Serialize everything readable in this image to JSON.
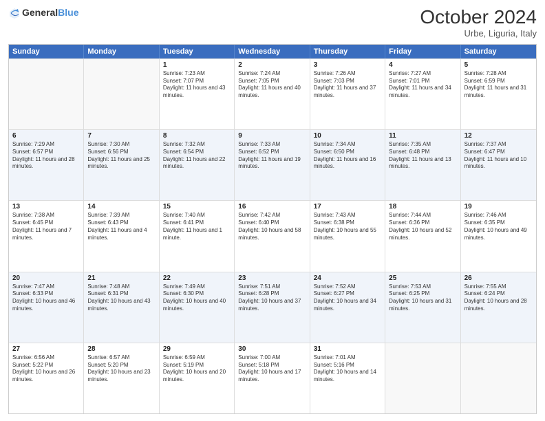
{
  "logo": {
    "text_general": "General",
    "text_blue": "Blue"
  },
  "header": {
    "month": "October 2024",
    "location": "Urbe, Liguria, Italy"
  },
  "weekdays": [
    "Sunday",
    "Monday",
    "Tuesday",
    "Wednesday",
    "Thursday",
    "Friday",
    "Saturday"
  ],
  "rows": [
    {
      "alt": false,
      "cells": [
        {
          "day": "",
          "empty": true,
          "info": ""
        },
        {
          "day": "",
          "empty": true,
          "info": ""
        },
        {
          "day": "1",
          "empty": false,
          "info": "Sunrise: 7:23 AM\nSunset: 7:07 PM\nDaylight: 11 hours and 43 minutes."
        },
        {
          "day": "2",
          "empty": false,
          "info": "Sunrise: 7:24 AM\nSunset: 7:05 PM\nDaylight: 11 hours and 40 minutes."
        },
        {
          "day": "3",
          "empty": false,
          "info": "Sunrise: 7:26 AM\nSunset: 7:03 PM\nDaylight: 11 hours and 37 minutes."
        },
        {
          "day": "4",
          "empty": false,
          "info": "Sunrise: 7:27 AM\nSunset: 7:01 PM\nDaylight: 11 hours and 34 minutes."
        },
        {
          "day": "5",
          "empty": false,
          "info": "Sunrise: 7:28 AM\nSunset: 6:59 PM\nDaylight: 11 hours and 31 minutes."
        }
      ]
    },
    {
      "alt": true,
      "cells": [
        {
          "day": "6",
          "empty": false,
          "info": "Sunrise: 7:29 AM\nSunset: 6:57 PM\nDaylight: 11 hours and 28 minutes."
        },
        {
          "day": "7",
          "empty": false,
          "info": "Sunrise: 7:30 AM\nSunset: 6:56 PM\nDaylight: 11 hours and 25 minutes."
        },
        {
          "day": "8",
          "empty": false,
          "info": "Sunrise: 7:32 AM\nSunset: 6:54 PM\nDaylight: 11 hours and 22 minutes."
        },
        {
          "day": "9",
          "empty": false,
          "info": "Sunrise: 7:33 AM\nSunset: 6:52 PM\nDaylight: 11 hours and 19 minutes."
        },
        {
          "day": "10",
          "empty": false,
          "info": "Sunrise: 7:34 AM\nSunset: 6:50 PM\nDaylight: 11 hours and 16 minutes."
        },
        {
          "day": "11",
          "empty": false,
          "info": "Sunrise: 7:35 AM\nSunset: 6:48 PM\nDaylight: 11 hours and 13 minutes."
        },
        {
          "day": "12",
          "empty": false,
          "info": "Sunrise: 7:37 AM\nSunset: 6:47 PM\nDaylight: 11 hours and 10 minutes."
        }
      ]
    },
    {
      "alt": false,
      "cells": [
        {
          "day": "13",
          "empty": false,
          "info": "Sunrise: 7:38 AM\nSunset: 6:45 PM\nDaylight: 11 hours and 7 minutes."
        },
        {
          "day": "14",
          "empty": false,
          "info": "Sunrise: 7:39 AM\nSunset: 6:43 PM\nDaylight: 11 hours and 4 minutes."
        },
        {
          "day": "15",
          "empty": false,
          "info": "Sunrise: 7:40 AM\nSunset: 6:41 PM\nDaylight: 11 hours and 1 minute."
        },
        {
          "day": "16",
          "empty": false,
          "info": "Sunrise: 7:42 AM\nSunset: 6:40 PM\nDaylight: 10 hours and 58 minutes."
        },
        {
          "day": "17",
          "empty": false,
          "info": "Sunrise: 7:43 AM\nSunset: 6:38 PM\nDaylight: 10 hours and 55 minutes."
        },
        {
          "day": "18",
          "empty": false,
          "info": "Sunrise: 7:44 AM\nSunset: 6:36 PM\nDaylight: 10 hours and 52 minutes."
        },
        {
          "day": "19",
          "empty": false,
          "info": "Sunrise: 7:46 AM\nSunset: 6:35 PM\nDaylight: 10 hours and 49 minutes."
        }
      ]
    },
    {
      "alt": true,
      "cells": [
        {
          "day": "20",
          "empty": false,
          "info": "Sunrise: 7:47 AM\nSunset: 6:33 PM\nDaylight: 10 hours and 46 minutes."
        },
        {
          "day": "21",
          "empty": false,
          "info": "Sunrise: 7:48 AM\nSunset: 6:31 PM\nDaylight: 10 hours and 43 minutes."
        },
        {
          "day": "22",
          "empty": false,
          "info": "Sunrise: 7:49 AM\nSunset: 6:30 PM\nDaylight: 10 hours and 40 minutes."
        },
        {
          "day": "23",
          "empty": false,
          "info": "Sunrise: 7:51 AM\nSunset: 6:28 PM\nDaylight: 10 hours and 37 minutes."
        },
        {
          "day": "24",
          "empty": false,
          "info": "Sunrise: 7:52 AM\nSunset: 6:27 PM\nDaylight: 10 hours and 34 minutes."
        },
        {
          "day": "25",
          "empty": false,
          "info": "Sunrise: 7:53 AM\nSunset: 6:25 PM\nDaylight: 10 hours and 31 minutes."
        },
        {
          "day": "26",
          "empty": false,
          "info": "Sunrise: 7:55 AM\nSunset: 6:24 PM\nDaylight: 10 hours and 28 minutes."
        }
      ]
    },
    {
      "alt": false,
      "cells": [
        {
          "day": "27",
          "empty": false,
          "info": "Sunrise: 6:56 AM\nSunset: 5:22 PM\nDaylight: 10 hours and 26 minutes."
        },
        {
          "day": "28",
          "empty": false,
          "info": "Sunrise: 6:57 AM\nSunset: 5:20 PM\nDaylight: 10 hours and 23 minutes."
        },
        {
          "day": "29",
          "empty": false,
          "info": "Sunrise: 6:59 AM\nSunset: 5:19 PM\nDaylight: 10 hours and 20 minutes."
        },
        {
          "day": "30",
          "empty": false,
          "info": "Sunrise: 7:00 AM\nSunset: 5:18 PM\nDaylight: 10 hours and 17 minutes."
        },
        {
          "day": "31",
          "empty": false,
          "info": "Sunrise: 7:01 AM\nSunset: 5:16 PM\nDaylight: 10 hours and 14 minutes."
        },
        {
          "day": "",
          "empty": true,
          "info": ""
        },
        {
          "day": "",
          "empty": true,
          "info": ""
        }
      ]
    }
  ]
}
